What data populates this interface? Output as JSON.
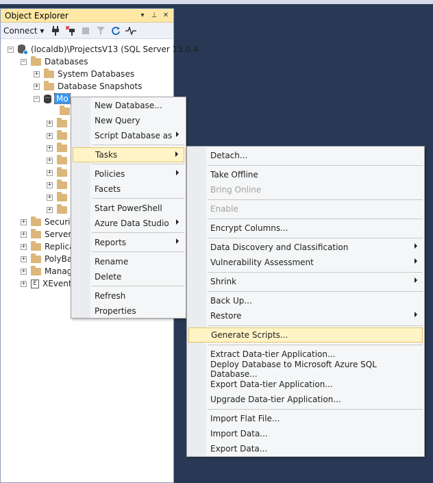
{
  "object_explorer": {
    "title": "Object Explorer",
    "controls": [
      "▾",
      "📌",
      "✕"
    ],
    "toolbar": {
      "connect_label": "Connect ▾"
    },
    "tree": {
      "server": "(localdb)\\ProjectsV13 (SQL Server 13.0.4",
      "databases": "Databases",
      "system_databases": "System Databases",
      "database_snapshots": "Database Snapshots",
      "selected_db": "Mo",
      "security": "Securit",
      "server_objects": "Server",
      "replication": "Replica",
      "polybase": "PolyBa",
      "management": "Manag",
      "xevent": "XEvent"
    }
  },
  "context_menu": {
    "items": [
      "New Database...",
      "New Query",
      "Script Database as",
      "Tasks",
      "Policies",
      "Facets",
      "Start PowerShell",
      "Azure Data Studio",
      "Reports",
      "Rename",
      "Delete",
      "Refresh",
      "Properties"
    ]
  },
  "tasks_menu": {
    "items": [
      "Detach...",
      "Take Offline",
      "Bring Online",
      "Enable",
      "Encrypt Columns...",
      "Data Discovery and Classification",
      "Vulnerability Assessment",
      "Shrink",
      "Back Up...",
      "Restore",
      "Generate Scripts...",
      "Extract Data-tier Application...",
      "Deploy Database to Microsoft Azure SQL Database...",
      "Export Data-tier Application...",
      "Upgrade Data-tier Application...",
      "Import Flat File...",
      "Import Data...",
      "Export Data..."
    ]
  },
  "colors": {
    "background": "#293955",
    "title_bar": "#ffe8a6",
    "highlight": "#fff4c6",
    "selection": "#3399ff"
  }
}
